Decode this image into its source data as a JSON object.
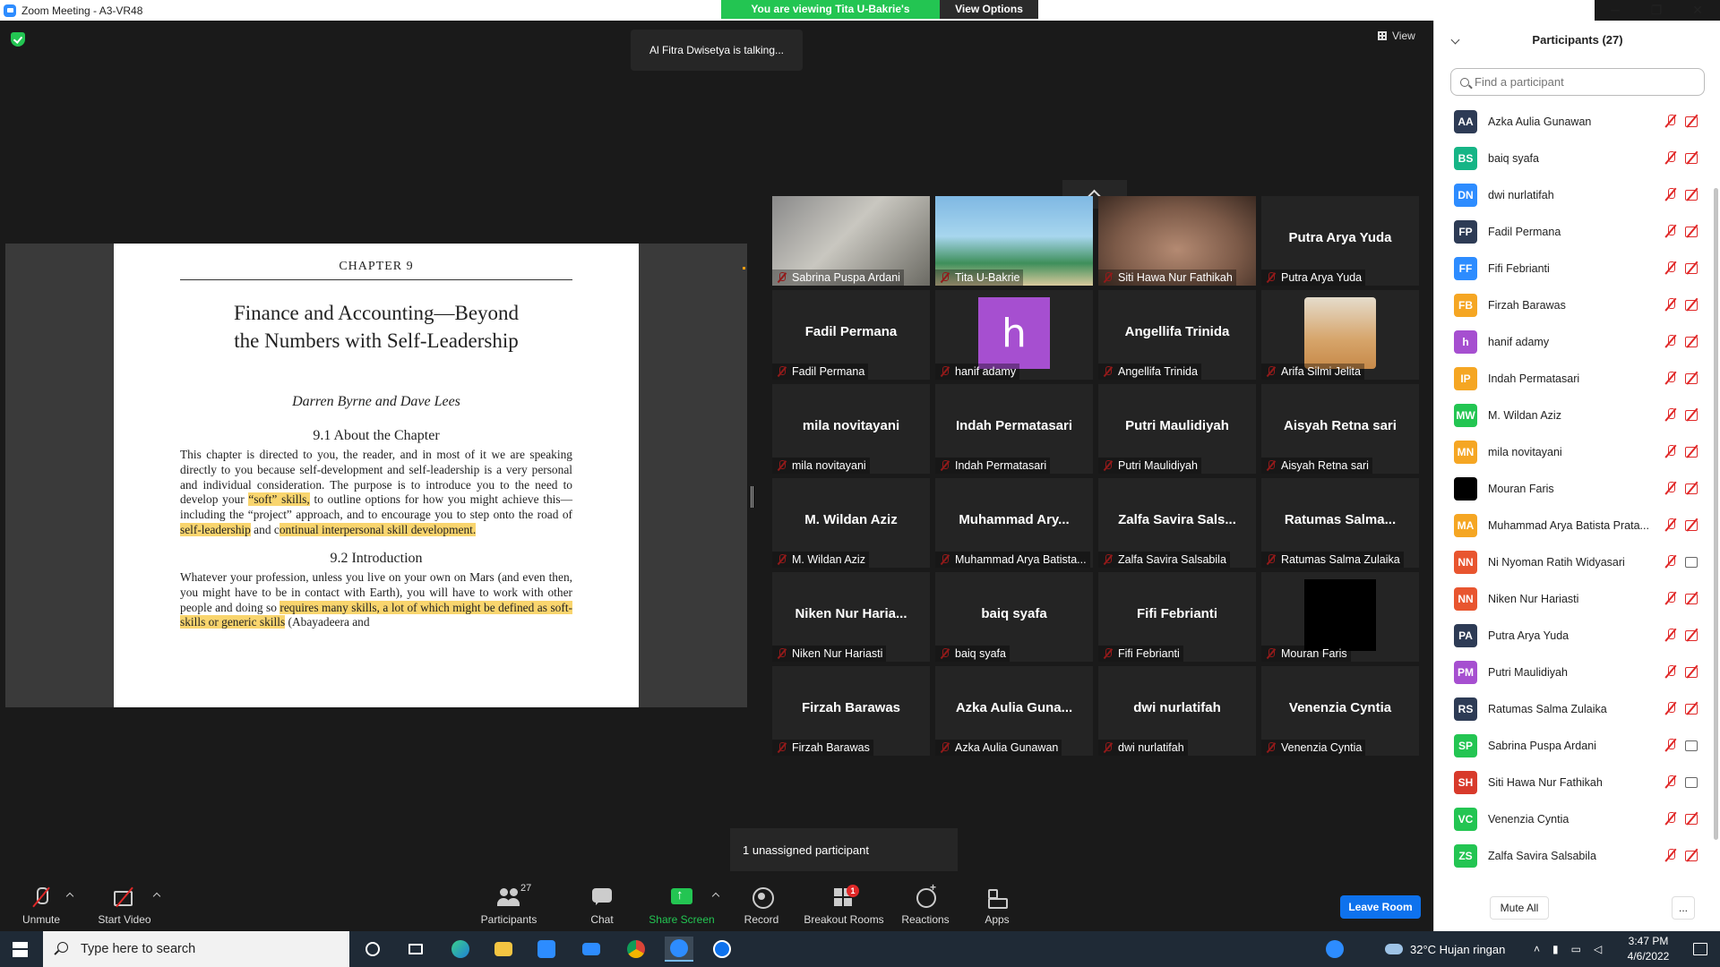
{
  "window": {
    "title": "Zoom Meeting - A3-VR48",
    "viewing_banner": "You are viewing Tita U-Bakrie's screen",
    "view_options": "View Options ⌄",
    "minimize": "─",
    "restore": "❐",
    "close": "✕"
  },
  "meeting": {
    "talking": "Al Fitra Dwisetya is talking...",
    "view_label": "View",
    "unassigned": "1 unassigned participant"
  },
  "document": {
    "chapter": "CHAPTER 9",
    "title_line1": "Finance and Accounting—Beyond",
    "title_line2": "the Numbers with Self-Leadership",
    "authors": "Darren Byrne and Dave Lees",
    "section1": "9.1    About the Chapter",
    "para1_a": "This chapter is directed to you, the reader, and in most of it we are speaking directly to you because self-development and self-leadership is a very personal and individual consideration. The purpose is to introduce you to the need to develop your ",
    "para1_hl1": "“soft” skills,",
    "para1_b": " to outline options for how you might achieve this—including the “project” approach, and to encourage you to step onto the road of ",
    "para1_hl2": "self-leadership",
    "para1_c": " and c",
    "para1_hl3": "ontinual interpersonal skill development.",
    "section2": "9.2    Introduction",
    "para2_a": "Whatever your profession, unless you live on your own on Mars (and even then, you might have to be in contact with Earth), you will have to work with other people and doing so ",
    "para2_hl1": "requires many skills, a lot of which might be defined as soft-skills or generic skills",
    "para2_b": " (Abayadeera and"
  },
  "gallery": [
    {
      "display": "",
      "label": "Sabrina Puspa Ardani",
      "kind": "photo-a"
    },
    {
      "display": "",
      "label": "Tita U-Bakrie",
      "kind": "photo-b"
    },
    {
      "display": "",
      "label": "Siti Hawa Nur Fathikah",
      "kind": "photo-c"
    },
    {
      "display": "Putra Arya Yuda",
      "label": "Putra Arya Yuda",
      "kind": "name"
    },
    {
      "display": "Fadil Permana",
      "label": "Fadil Permana",
      "kind": "name"
    },
    {
      "display": "h",
      "label": "hanif adamy",
      "kind": "avatar-h"
    },
    {
      "display": "Angellifa Trinida",
      "label": "Angellifa Trinida",
      "kind": "name"
    },
    {
      "display": "",
      "label": "Arifa Silmi Jelita",
      "kind": "avatar-bear"
    },
    {
      "display": "mila novitayani",
      "label": "mila novitayani",
      "kind": "name"
    },
    {
      "display": "Indah Permatasari",
      "label": "Indah Permatasari",
      "kind": "name"
    },
    {
      "display": "Putri Maulidiyah",
      "label": "Putri Maulidiyah",
      "kind": "name"
    },
    {
      "display": "Aisyah Retna sari",
      "label": "Aisyah Retna sari",
      "kind": "name"
    },
    {
      "display": "M. Wildan Aziz",
      "label": "M. Wildan Aziz",
      "kind": "name"
    },
    {
      "display": "Muhammad Ary...",
      "label": "Muhammad Arya Batista...",
      "kind": "name"
    },
    {
      "display": "Zalfa Savira Sals...",
      "label": "Zalfa Savira Salsabila",
      "kind": "name"
    },
    {
      "display": "Ratumas Salma...",
      "label": "Ratumas Salma Zulaika",
      "kind": "name"
    },
    {
      "display": "Niken Nur Haria...",
      "label": "Niken Nur Hariasti",
      "kind": "name"
    },
    {
      "display": "baiq syafa",
      "label": "baiq syafa",
      "kind": "name"
    },
    {
      "display": "Fifi Febrianti",
      "label": "Fifi Febrianti",
      "kind": "name"
    },
    {
      "display": "",
      "label": "Mouran Faris",
      "kind": "avatar-black"
    },
    {
      "display": "Firzah Barawas",
      "label": "Firzah Barawas",
      "kind": "name"
    },
    {
      "display": "Azka Aulia Guna...",
      "label": "Azka Aulia Gunawan",
      "kind": "name"
    },
    {
      "display": "dwi nurlatifah",
      "label": "dwi nurlatifah",
      "kind": "name"
    },
    {
      "display": "Venenzia Cyntia",
      "label": "Venenzia Cyntia",
      "kind": "name"
    }
  ],
  "toolbar": {
    "unmute": "Unmute",
    "start_video": "Start Video",
    "participants": "Participants",
    "participants_count": "27",
    "chat": "Chat",
    "share_screen": "Share Screen",
    "record": "Record",
    "breakout_rooms": "Breakout Rooms",
    "breakout_badge": "1",
    "reactions": "Reactions",
    "apps": "Apps",
    "leave_room": "Leave Room"
  },
  "panel": {
    "title": "Participants (27)",
    "search_placeholder": "Find a participant",
    "mute_all": "Mute All",
    "more": "...",
    "participants": [
      {
        "initials": "AA",
        "name": "Azka Aulia Gunawan",
        "color": "#2d3b55",
        "camera_on": false
      },
      {
        "initials": "BS",
        "name": "baiq syafa",
        "color": "#16b586",
        "camera_on": false
      },
      {
        "initials": "DN",
        "name": "dwi nurlatifah",
        "color": "#2d8cff",
        "camera_on": false
      },
      {
        "initials": "FP",
        "name": "Fadil Permana",
        "color": "#2d3b55",
        "camera_on": false
      },
      {
        "initials": "FF",
        "name": "Fifi Febrianti",
        "color": "#2d8cff",
        "camera_on": false
      },
      {
        "initials": "FB",
        "name": "Firzah Barawas",
        "color": "#f5a623",
        "camera_on": false
      },
      {
        "initials": "h",
        "name": "hanif adamy",
        "color": "#a64fd0",
        "camera_on": false
      },
      {
        "initials": "IP",
        "name": "Indah Permatasari",
        "color": "#f5a623",
        "camera_on": false
      },
      {
        "initials": "MW",
        "name": "M. Wildan Aziz",
        "color": "#23c552",
        "camera_on": false
      },
      {
        "initials": "MN",
        "name": "mila novitayani",
        "color": "#f5a623",
        "camera_on": false
      },
      {
        "initials": "",
        "name": "Mouran Faris",
        "color": "#000000",
        "camera_on": false
      },
      {
        "initials": "MA",
        "name": "Muhammad Arya Batista Prata...",
        "color": "#f5a623",
        "camera_on": false
      },
      {
        "initials": "NN",
        "name": "Ni Nyoman Ratih Widyasari",
        "color": "#e8552f",
        "camera_on": true
      },
      {
        "initials": "NN",
        "name": "Niken Nur Hariasti",
        "color": "#e8552f",
        "camera_on": false
      },
      {
        "initials": "PA",
        "name": "Putra Arya Yuda",
        "color": "#2d3b55",
        "camera_on": false
      },
      {
        "initials": "PM",
        "name": "Putri Maulidiyah",
        "color": "#a64fd0",
        "camera_on": false
      },
      {
        "initials": "RS",
        "name": "Ratumas Salma Zulaika",
        "color": "#2d3b55",
        "camera_on": false
      },
      {
        "initials": "SP",
        "name": "Sabrina Puspa Ardani",
        "color": "#23c552",
        "camera_on": true
      },
      {
        "initials": "SH",
        "name": "Siti Hawa Nur Fathikah",
        "color": "#d83a2b",
        "camera_on": true
      },
      {
        "initials": "VC",
        "name": "Venenzia Cyntia",
        "color": "#23c552",
        "camera_on": false
      },
      {
        "initials": "ZS",
        "name": "Zalfa Savira Salsabila",
        "color": "#23c552",
        "camera_on": false
      }
    ]
  },
  "taskbar": {
    "search_text": "Type here to search",
    "weather": "32°C  Hujan ringan",
    "time": "3:47 PM",
    "date": "4/6/2022"
  }
}
